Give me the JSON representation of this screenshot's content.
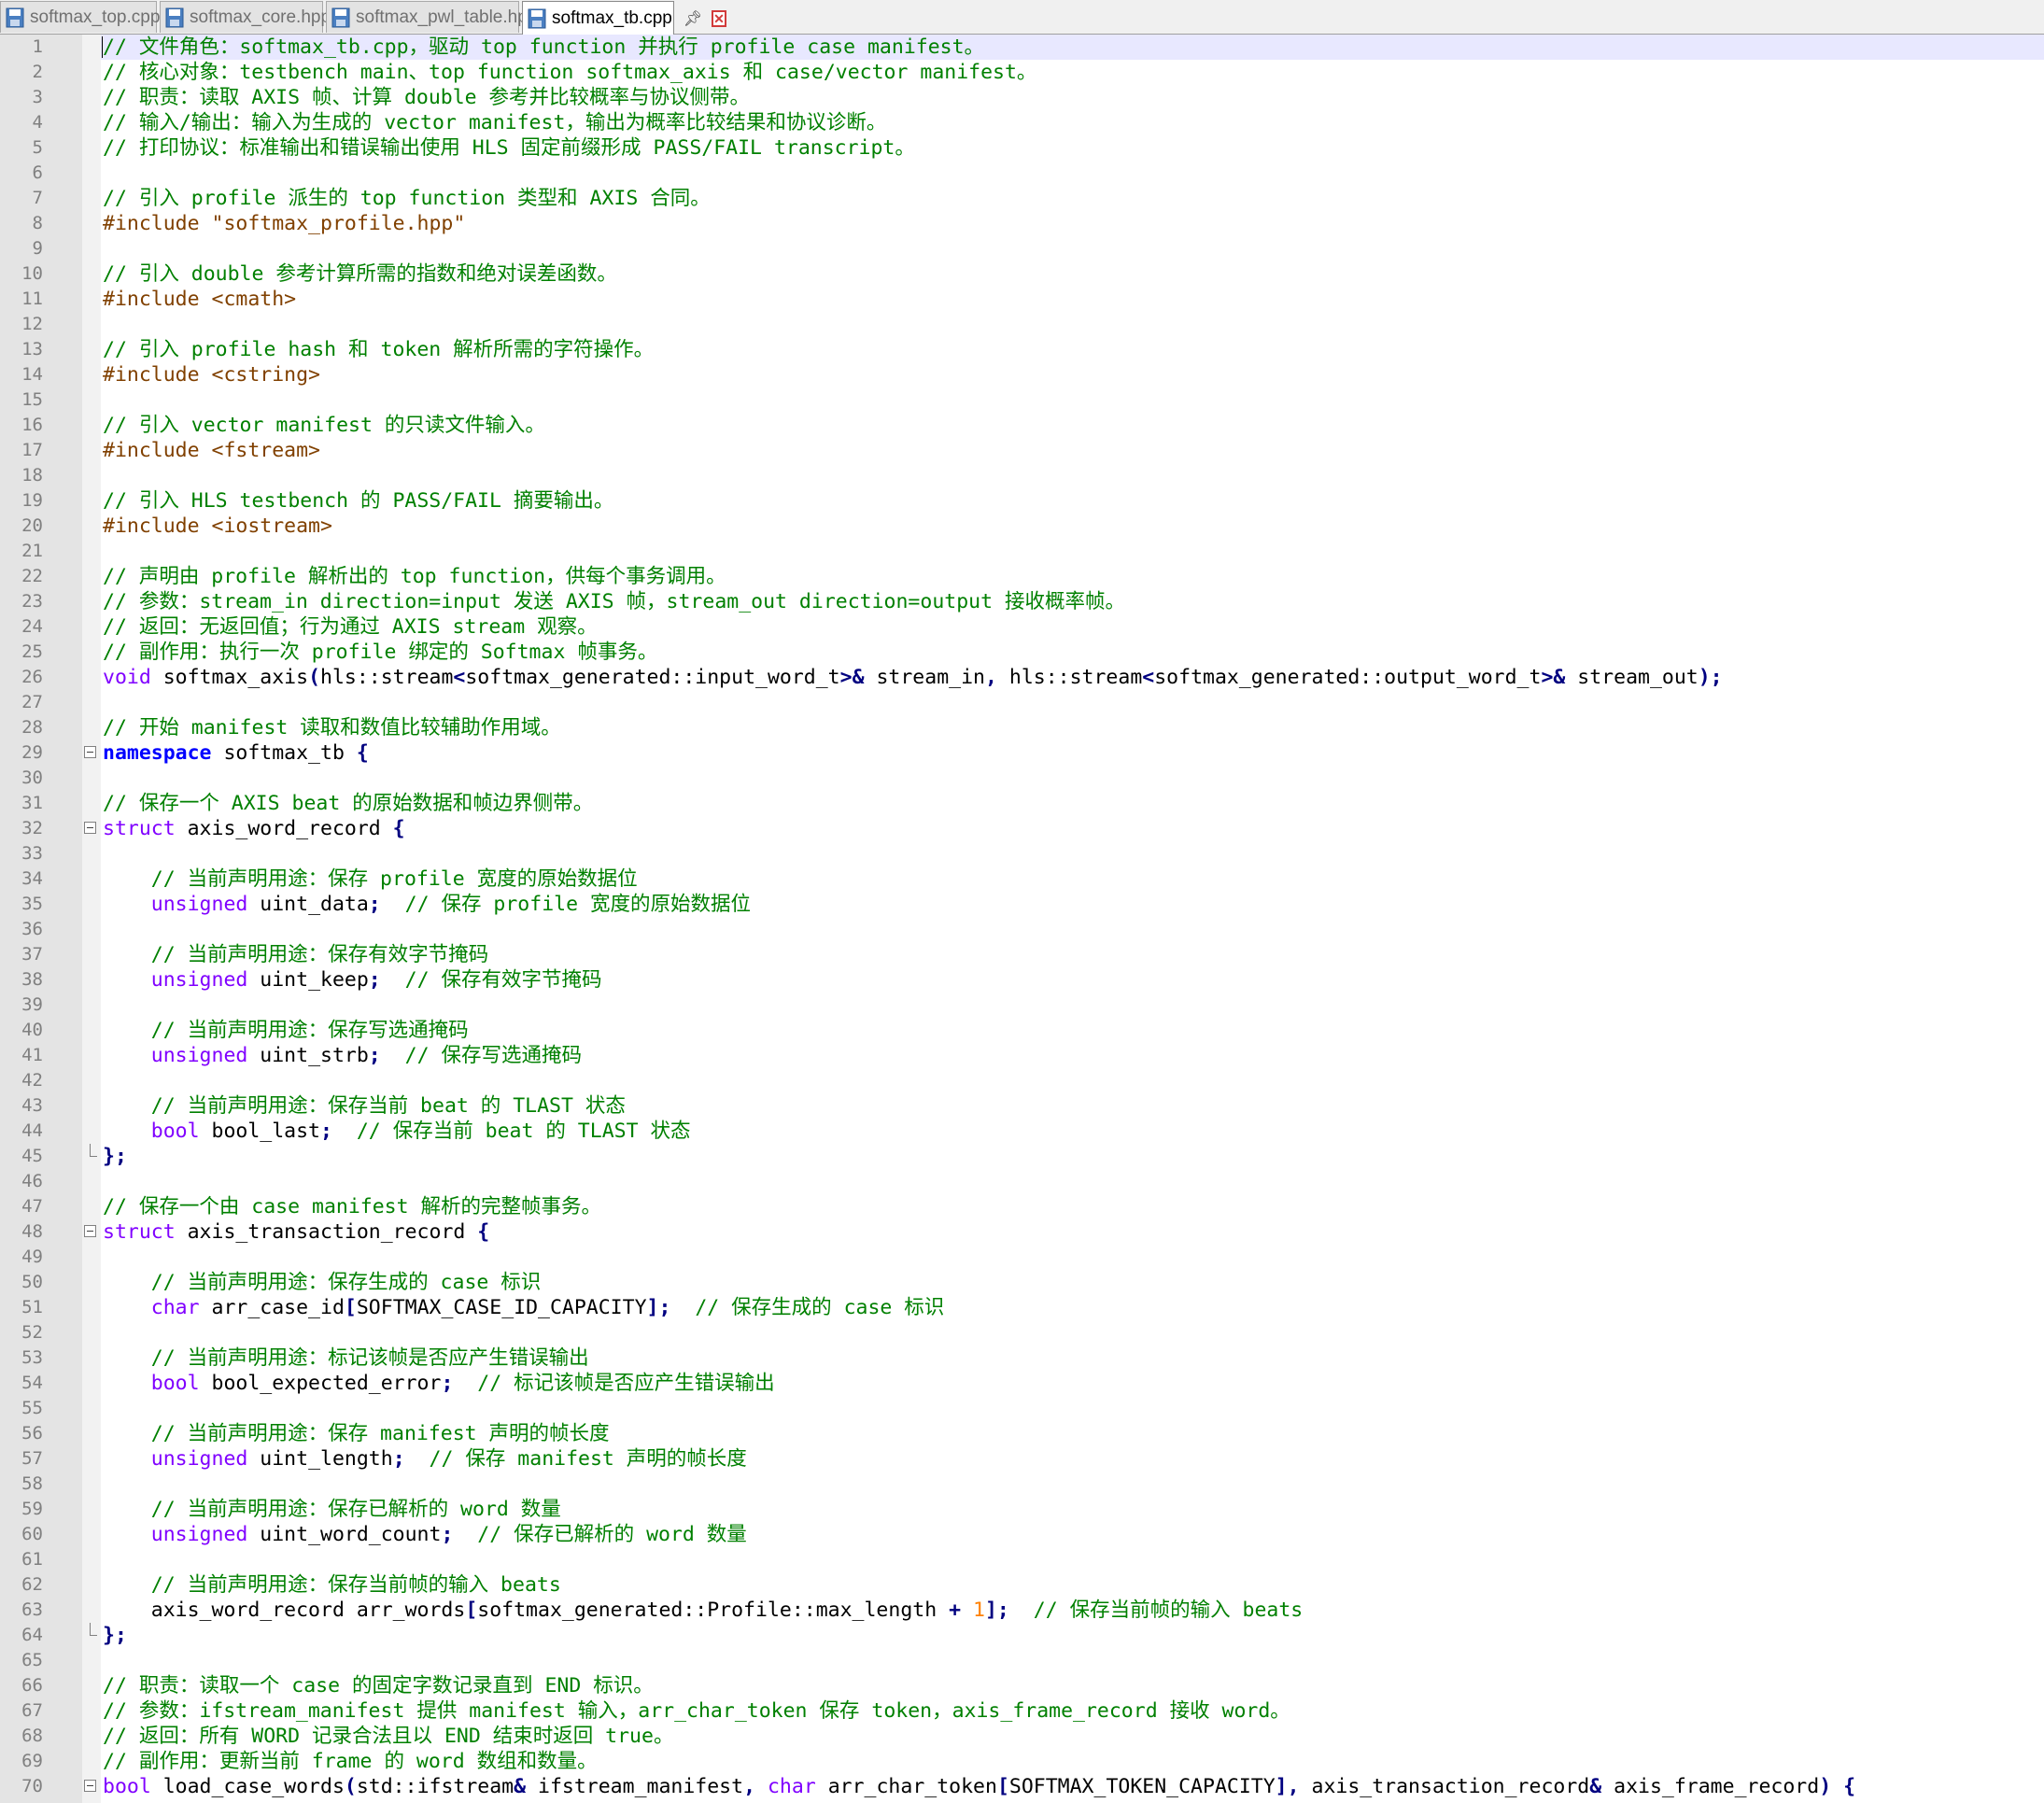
{
  "tabs": [
    {
      "label": "softmax_top.cpp",
      "active": false
    },
    {
      "label": "softmax_core.hpp",
      "active": false
    },
    {
      "label": "softmax_pwl_table.hpp",
      "active": false
    },
    {
      "label": "softmax_tb.cpp",
      "active": true
    }
  ],
  "active_tab_icons": {
    "pin": "pin-icon",
    "close": "close-tab-icon"
  },
  "colors": {
    "comment": "#008000",
    "preprocessor": "#804000",
    "type": "#8000ff",
    "keyword": "#0000ff",
    "operator": "#000080",
    "number": "#ff8000",
    "line_number": "#808080",
    "current_line": "#e8e8ff",
    "close_icon": "#d23a3a"
  },
  "editor": {
    "current_line": 1,
    "lines": [
      {
        "n": "1",
        "fold": "",
        "s": [
          [
            "c",
            "// 文件角色：softmax_tb.cpp，驱动 top function 并执行 profile case manifest。"
          ]
        ]
      },
      {
        "n": "2",
        "fold": "",
        "s": [
          [
            "c",
            "// 核心对象：testbench main、top function softmax_axis 和 case/vector manifest。"
          ]
        ]
      },
      {
        "n": "3",
        "fold": "",
        "s": [
          [
            "c",
            "// 职责：读取 AXIS 帧、计算 double 参考并比较概率与协议侧带。"
          ]
        ]
      },
      {
        "n": "4",
        "fold": "",
        "s": [
          [
            "c",
            "// 输入/输出：输入为生成的 vector manifest，输出为概率比较结果和协议诊断。"
          ]
        ]
      },
      {
        "n": "5",
        "fold": "",
        "s": [
          [
            "c",
            "// 打印协议：标准输出和错误输出使用 HLS 固定前缀形成 PASS/FAIL transcript。"
          ]
        ]
      },
      {
        "n": "6",
        "fold": "",
        "s": []
      },
      {
        "n": "7",
        "fold": "",
        "s": [
          [
            "c",
            "// 引入 profile 派生的 top function 类型和 AXIS 合同。"
          ]
        ]
      },
      {
        "n": "8",
        "fold": "",
        "s": [
          [
            "p",
            "#include \"softmax_profile.hpp\""
          ]
        ]
      },
      {
        "n": "9",
        "fold": "",
        "s": []
      },
      {
        "n": "10",
        "fold": "",
        "s": [
          [
            "c",
            "// 引入 double 参考计算所需的指数和绝对误差函数。"
          ]
        ]
      },
      {
        "n": "11",
        "fold": "",
        "s": [
          [
            "p",
            "#include <cmath>"
          ]
        ]
      },
      {
        "n": "12",
        "fold": "",
        "s": []
      },
      {
        "n": "13",
        "fold": "",
        "s": [
          [
            "c",
            "// 引入 profile hash 和 token 解析所需的字符操作。"
          ]
        ]
      },
      {
        "n": "14",
        "fold": "",
        "s": [
          [
            "p",
            "#include <cstring>"
          ]
        ]
      },
      {
        "n": "15",
        "fold": "",
        "s": []
      },
      {
        "n": "16",
        "fold": "",
        "s": [
          [
            "c",
            "// 引入 vector manifest 的只读文件输入。"
          ]
        ]
      },
      {
        "n": "17",
        "fold": "",
        "s": [
          [
            "p",
            "#include <fstream>"
          ]
        ]
      },
      {
        "n": "18",
        "fold": "",
        "s": []
      },
      {
        "n": "19",
        "fold": "",
        "s": [
          [
            "c",
            "// 引入 HLS testbench 的 PASS/FAIL 摘要输出。"
          ]
        ]
      },
      {
        "n": "20",
        "fold": "",
        "s": [
          [
            "p",
            "#include <iostream>"
          ]
        ]
      },
      {
        "n": "21",
        "fold": "",
        "s": []
      },
      {
        "n": "22",
        "fold": "",
        "s": [
          [
            "c",
            "// 声明由 profile 解析出的 top function，供每个事务调用。"
          ]
        ]
      },
      {
        "n": "23",
        "fold": "",
        "s": [
          [
            "c",
            "// 参数：stream_in direction=input 发送 AXIS 帧，stream_out direction=output 接收概率帧。"
          ]
        ]
      },
      {
        "n": "24",
        "fold": "",
        "s": [
          [
            "c",
            "// 返回：无返回值；行为通过 AXIS stream 观察。"
          ]
        ]
      },
      {
        "n": "25",
        "fold": "",
        "s": [
          [
            "c",
            "// 副作用：执行一次 profile 绑定的 Softmax 帧事务。"
          ]
        ]
      },
      {
        "n": "26",
        "fold": "",
        "s": [
          [
            "t",
            "void"
          ],
          [
            "x",
            " softmax_axis"
          ],
          [
            "o",
            "("
          ],
          [
            "x",
            "hls::stream"
          ],
          [
            "o",
            "<"
          ],
          [
            "x",
            "softmax_generated::input_word_t"
          ],
          [
            "o",
            ">&"
          ],
          [
            "x",
            " stream_in"
          ],
          [
            "o",
            ","
          ],
          [
            "x",
            " hls::stream"
          ],
          [
            "o",
            "<"
          ],
          [
            "x",
            "softmax_generated::output_word_t"
          ],
          [
            "o",
            ">&"
          ],
          [
            "x",
            " stream_out"
          ],
          [
            "o",
            ");"
          ]
        ]
      },
      {
        "n": "27",
        "fold": "",
        "s": []
      },
      {
        "n": "28",
        "fold": "",
        "s": [
          [
            "c",
            "// 开始 manifest 读取和数值比较辅助作用域。"
          ]
        ]
      },
      {
        "n": "29",
        "fold": "open",
        "s": [
          [
            "k",
            "namespace"
          ],
          [
            "x",
            " softmax_tb "
          ],
          [
            "o",
            "{"
          ]
        ]
      },
      {
        "n": "30",
        "fold": "",
        "s": []
      },
      {
        "n": "31",
        "fold": "",
        "s": [
          [
            "c",
            "// 保存一个 AXIS beat 的原始数据和帧边界侧带。"
          ]
        ]
      },
      {
        "n": "32",
        "fold": "open",
        "s": [
          [
            "t",
            "struct"
          ],
          [
            "x",
            " axis_word_record "
          ],
          [
            "o",
            "{"
          ]
        ]
      },
      {
        "n": "33",
        "fold": "",
        "s": []
      },
      {
        "n": "34",
        "fold": "",
        "s": [
          [
            "x",
            "    "
          ],
          [
            "c",
            "// 当前声明用途：保存 profile 宽度的原始数据位"
          ]
        ]
      },
      {
        "n": "35",
        "fold": "",
        "s": [
          [
            "x",
            "    "
          ],
          [
            "t",
            "unsigned"
          ],
          [
            "x",
            " uint_data"
          ],
          [
            "o",
            ";"
          ],
          [
            "x",
            "  "
          ],
          [
            "c",
            "// 保存 profile 宽度的原始数据位"
          ]
        ]
      },
      {
        "n": "36",
        "fold": "",
        "s": []
      },
      {
        "n": "37",
        "fold": "",
        "s": [
          [
            "x",
            "    "
          ],
          [
            "c",
            "// 当前声明用途：保存有效字节掩码"
          ]
        ]
      },
      {
        "n": "38",
        "fold": "",
        "s": [
          [
            "x",
            "    "
          ],
          [
            "t",
            "unsigned"
          ],
          [
            "x",
            " uint_keep"
          ],
          [
            "o",
            ";"
          ],
          [
            "x",
            "  "
          ],
          [
            "c",
            "// 保存有效字节掩码"
          ]
        ]
      },
      {
        "n": "39",
        "fold": "",
        "s": []
      },
      {
        "n": "40",
        "fold": "",
        "s": [
          [
            "x",
            "    "
          ],
          [
            "c",
            "// 当前声明用途：保存写选通掩码"
          ]
        ]
      },
      {
        "n": "41",
        "fold": "",
        "s": [
          [
            "x",
            "    "
          ],
          [
            "t",
            "unsigned"
          ],
          [
            "x",
            " uint_strb"
          ],
          [
            "o",
            ";"
          ],
          [
            "x",
            "  "
          ],
          [
            "c",
            "// 保存写选通掩码"
          ]
        ]
      },
      {
        "n": "42",
        "fold": "",
        "s": []
      },
      {
        "n": "43",
        "fold": "",
        "s": [
          [
            "x",
            "    "
          ],
          [
            "c",
            "// 当前声明用途：保存当前 beat 的 TLAST 状态"
          ]
        ]
      },
      {
        "n": "44",
        "fold": "",
        "s": [
          [
            "x",
            "    "
          ],
          [
            "t",
            "bool"
          ],
          [
            "x",
            " bool_last"
          ],
          [
            "o",
            ";"
          ],
          [
            "x",
            "  "
          ],
          [
            "c",
            "// 保存当前 beat 的 TLAST 状态"
          ]
        ]
      },
      {
        "n": "45",
        "fold": "end",
        "s": [
          [
            "o",
            "};"
          ]
        ]
      },
      {
        "n": "46",
        "fold": "",
        "s": []
      },
      {
        "n": "47",
        "fold": "",
        "s": [
          [
            "c",
            "// 保存一个由 case manifest 解析的完整帧事务。"
          ]
        ]
      },
      {
        "n": "48",
        "fold": "open",
        "s": [
          [
            "t",
            "struct"
          ],
          [
            "x",
            " axis_transaction_record "
          ],
          [
            "o",
            "{"
          ]
        ]
      },
      {
        "n": "49",
        "fold": "",
        "s": []
      },
      {
        "n": "50",
        "fold": "",
        "s": [
          [
            "x",
            "    "
          ],
          [
            "c",
            "// 当前声明用途：保存生成的 case 标识"
          ]
        ]
      },
      {
        "n": "51",
        "fold": "",
        "s": [
          [
            "x",
            "    "
          ],
          [
            "t",
            "char"
          ],
          [
            "x",
            " arr_case_id"
          ],
          [
            "o",
            "["
          ],
          [
            "x",
            "SOFTMAX_CASE_ID_CAPACITY"
          ],
          [
            "o",
            "];"
          ],
          [
            "x",
            "  "
          ],
          [
            "c",
            "// 保存生成的 case 标识"
          ]
        ]
      },
      {
        "n": "52",
        "fold": "",
        "s": []
      },
      {
        "n": "53",
        "fold": "",
        "s": [
          [
            "x",
            "    "
          ],
          [
            "c",
            "// 当前声明用途：标记该帧是否应产生错误输出"
          ]
        ]
      },
      {
        "n": "54",
        "fold": "",
        "s": [
          [
            "x",
            "    "
          ],
          [
            "t",
            "bool"
          ],
          [
            "x",
            " bool_expected_error"
          ],
          [
            "o",
            ";"
          ],
          [
            "x",
            "  "
          ],
          [
            "c",
            "// 标记该帧是否应产生错误输出"
          ]
        ]
      },
      {
        "n": "55",
        "fold": "",
        "s": []
      },
      {
        "n": "56",
        "fold": "",
        "s": [
          [
            "x",
            "    "
          ],
          [
            "c",
            "// 当前声明用途：保存 manifest 声明的帧长度"
          ]
        ]
      },
      {
        "n": "57",
        "fold": "",
        "s": [
          [
            "x",
            "    "
          ],
          [
            "t",
            "unsigned"
          ],
          [
            "x",
            " uint_length"
          ],
          [
            "o",
            ";"
          ],
          [
            "x",
            "  "
          ],
          [
            "c",
            "// 保存 manifest 声明的帧长度"
          ]
        ]
      },
      {
        "n": "58",
        "fold": "",
        "s": []
      },
      {
        "n": "59",
        "fold": "",
        "s": [
          [
            "x",
            "    "
          ],
          [
            "c",
            "// 当前声明用途：保存已解析的 word 数量"
          ]
        ]
      },
      {
        "n": "60",
        "fold": "",
        "s": [
          [
            "x",
            "    "
          ],
          [
            "t",
            "unsigned"
          ],
          [
            "x",
            " uint_word_count"
          ],
          [
            "o",
            ";"
          ],
          [
            "x",
            "  "
          ],
          [
            "c",
            "// 保存已解析的 word 数量"
          ]
        ]
      },
      {
        "n": "61",
        "fold": "",
        "s": []
      },
      {
        "n": "62",
        "fold": "",
        "s": [
          [
            "x",
            "    "
          ],
          [
            "c",
            "// 当前声明用途：保存当前帧的输入 beats"
          ]
        ]
      },
      {
        "n": "63",
        "fold": "",
        "s": [
          [
            "x",
            "    axis_word_record arr_words"
          ],
          [
            "o",
            "["
          ],
          [
            "x",
            "softmax_generated::Profile::max_length "
          ],
          [
            "o",
            "+"
          ],
          [
            "x",
            " "
          ],
          [
            "n",
            "1"
          ],
          [
            "o",
            "];"
          ],
          [
            "x",
            "  "
          ],
          [
            "c",
            "// 保存当前帧的输入 beats"
          ]
        ]
      },
      {
        "n": "64",
        "fold": "end",
        "s": [
          [
            "o",
            "};"
          ]
        ]
      },
      {
        "n": "65",
        "fold": "",
        "s": []
      },
      {
        "n": "66",
        "fold": "",
        "s": [
          [
            "c",
            "// 职责：读取一个 case 的固定字数记录直到 END 标识。"
          ]
        ]
      },
      {
        "n": "67",
        "fold": "",
        "s": [
          [
            "c",
            "// 参数：ifstream_manifest 提供 manifest 输入，arr_char_token 保存 token，axis_frame_record 接收 word。"
          ]
        ]
      },
      {
        "n": "68",
        "fold": "",
        "s": [
          [
            "c",
            "// 返回：所有 WORD 记录合法且以 END 结束时返回 true。"
          ]
        ]
      },
      {
        "n": "69",
        "fold": "",
        "s": [
          [
            "c",
            "// 副作用：更新当前 frame 的 word 数组和数量。"
          ]
        ]
      },
      {
        "n": "70",
        "fold": "open",
        "s": [
          [
            "t",
            "bool"
          ],
          [
            "x",
            " load_case_words"
          ],
          [
            "o",
            "("
          ],
          [
            "x",
            "std::ifstream"
          ],
          [
            "o",
            "&"
          ],
          [
            "x",
            " ifstream_manifest"
          ],
          [
            "o",
            ","
          ],
          [
            "x",
            " "
          ],
          [
            "t",
            "char"
          ],
          [
            "x",
            " arr_char_token"
          ],
          [
            "o",
            "["
          ],
          [
            "x",
            "SOFTMAX_TOKEN_CAPACITY"
          ],
          [
            "o",
            "],"
          ],
          [
            "x",
            " axis_transaction_record"
          ],
          [
            "o",
            "&"
          ],
          [
            "x",
            " axis_frame_record"
          ],
          [
            "o",
            ")"
          ],
          [
            "x",
            " "
          ],
          [
            "o",
            "{"
          ]
        ]
      }
    ]
  }
}
